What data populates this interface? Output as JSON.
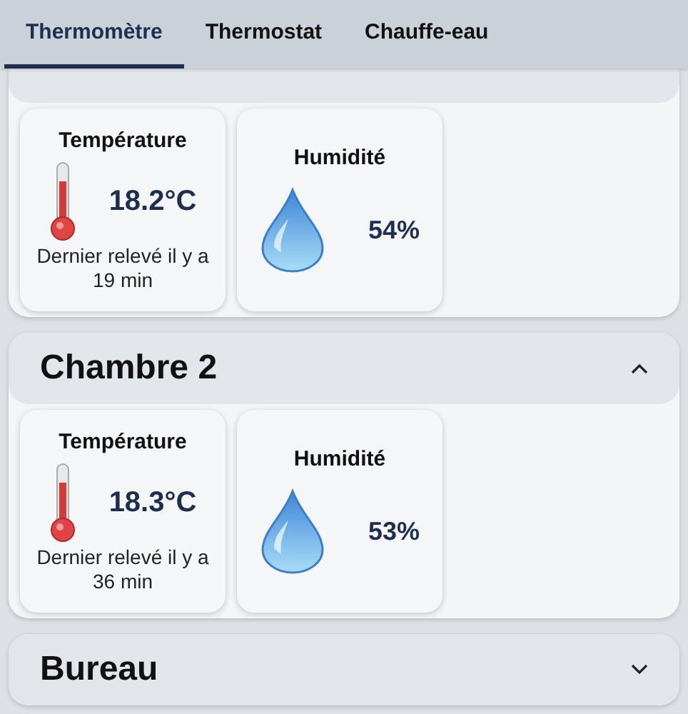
{
  "tabs": [
    {
      "label": "Thermomètre",
      "selected": true
    },
    {
      "label": "Thermostat",
      "selected": false
    },
    {
      "label": "Chauffe-eau",
      "selected": false
    }
  ],
  "sections": [
    {
      "sensors": [
        {
          "kind": "temperature",
          "label": "Température",
          "value": "18.2°C",
          "note": "Dernier relevé il y a 19 min"
        },
        {
          "kind": "humidity",
          "label": "Humidité",
          "value": "54%"
        }
      ]
    },
    {
      "title": "Chambre 2",
      "expanded": true,
      "sensors": [
        {
          "kind": "temperature",
          "label": "Température",
          "value": "18.3°C",
          "note": "Dernier relevé il y a 36 min"
        },
        {
          "kind": "humidity",
          "label": "Humidité",
          "value": "53%"
        }
      ]
    },
    {
      "title": "Bureau",
      "expanded": false
    }
  ]
}
